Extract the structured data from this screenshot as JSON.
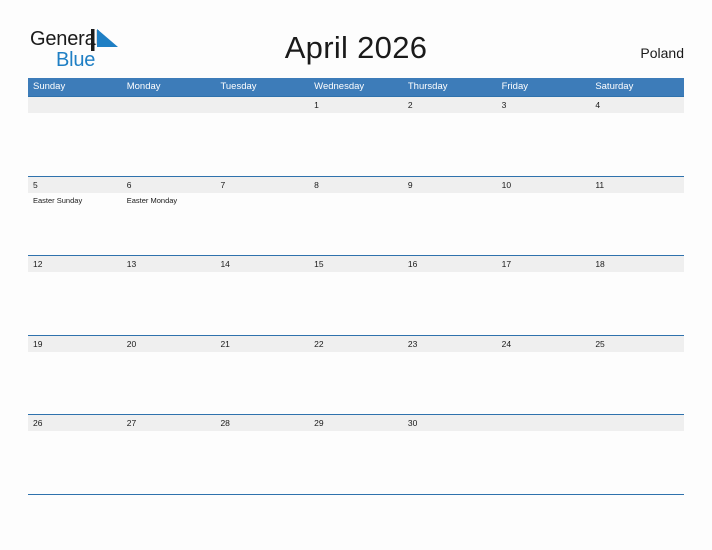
{
  "logo": {
    "word1": "General",
    "word2": "Blue",
    "mark": "triangle-mark",
    "accent_color": "#1f7fc4"
  },
  "header": {
    "title": "April 2026",
    "country": "Poland"
  },
  "calendar": {
    "header_color": "#3d7cb9",
    "line_color": "#2f72ad",
    "band_color": "#efefef",
    "weekdays": [
      "Sunday",
      "Monday",
      "Tuesday",
      "Wednesday",
      "Thursday",
      "Friday",
      "Saturday"
    ],
    "weeks": [
      [
        {
          "day": "",
          "event": ""
        },
        {
          "day": "",
          "event": ""
        },
        {
          "day": "",
          "event": ""
        },
        {
          "day": "1",
          "event": ""
        },
        {
          "day": "2",
          "event": ""
        },
        {
          "day": "3",
          "event": ""
        },
        {
          "day": "4",
          "event": ""
        }
      ],
      [
        {
          "day": "5",
          "event": "Easter Sunday"
        },
        {
          "day": "6",
          "event": "Easter Monday"
        },
        {
          "day": "7",
          "event": ""
        },
        {
          "day": "8",
          "event": ""
        },
        {
          "day": "9",
          "event": ""
        },
        {
          "day": "10",
          "event": ""
        },
        {
          "day": "11",
          "event": ""
        }
      ],
      [
        {
          "day": "12",
          "event": ""
        },
        {
          "day": "13",
          "event": ""
        },
        {
          "day": "14",
          "event": ""
        },
        {
          "day": "15",
          "event": ""
        },
        {
          "day": "16",
          "event": ""
        },
        {
          "day": "17",
          "event": ""
        },
        {
          "day": "18",
          "event": ""
        }
      ],
      [
        {
          "day": "19",
          "event": ""
        },
        {
          "day": "20",
          "event": ""
        },
        {
          "day": "21",
          "event": ""
        },
        {
          "day": "22",
          "event": ""
        },
        {
          "day": "23",
          "event": ""
        },
        {
          "day": "24",
          "event": ""
        },
        {
          "day": "25",
          "event": ""
        }
      ],
      [
        {
          "day": "26",
          "event": ""
        },
        {
          "day": "27",
          "event": ""
        },
        {
          "day": "28",
          "event": ""
        },
        {
          "day": "29",
          "event": ""
        },
        {
          "day": "30",
          "event": ""
        },
        {
          "day": "",
          "event": ""
        },
        {
          "day": "",
          "event": ""
        }
      ]
    ]
  }
}
